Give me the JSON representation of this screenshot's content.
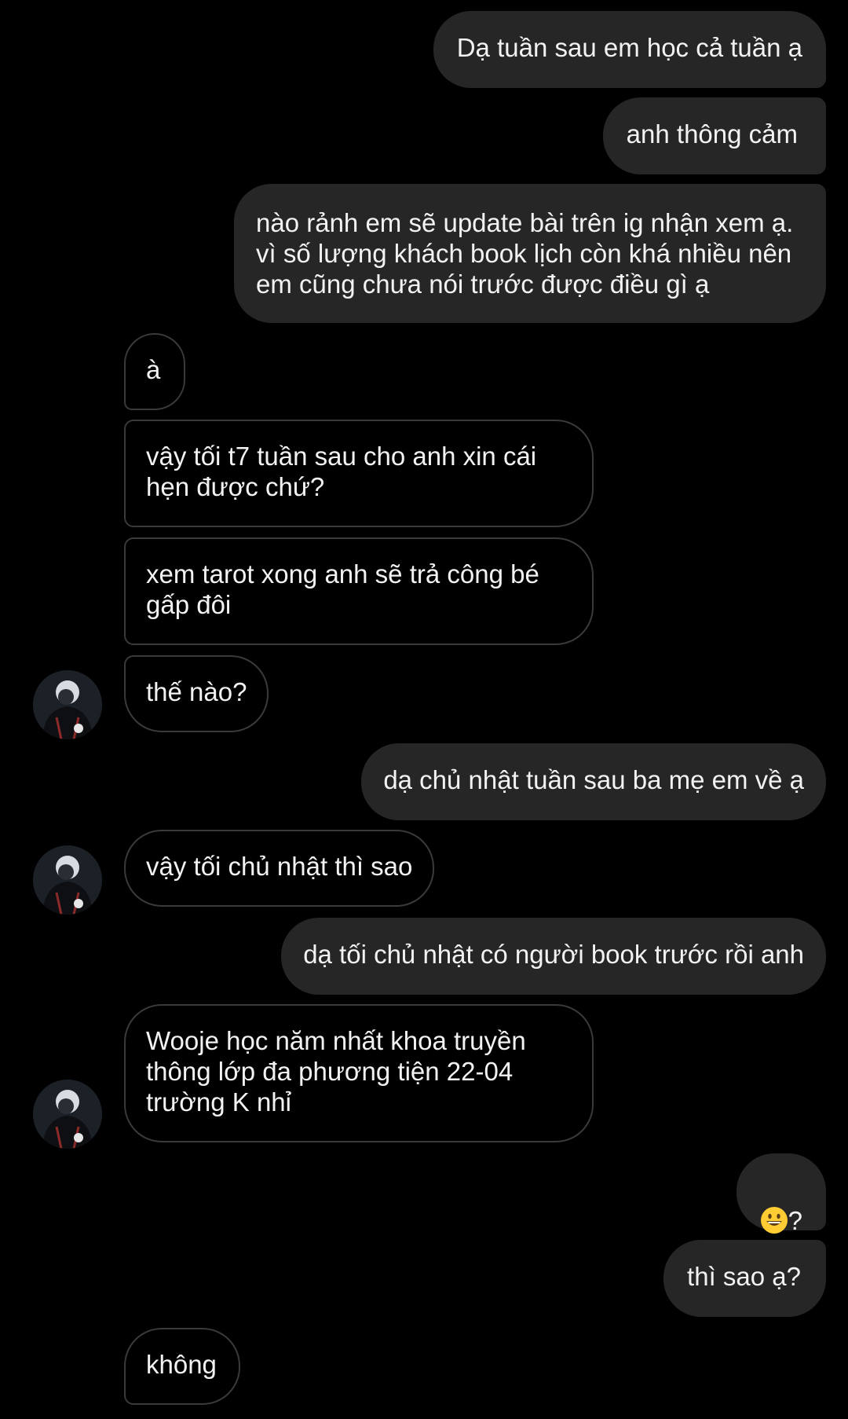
{
  "colors": {
    "background": "#000000",
    "outgoing_bubble": "#262626",
    "incoming_border": "#3a3a3a",
    "text": "#f2f2f2"
  },
  "messages": [
    {
      "id": "m1",
      "sender": "me",
      "text": "Dạ tuần sau em học cả tuần ạ"
    },
    {
      "id": "m2",
      "sender": "me",
      "text": "anh thông cảm"
    },
    {
      "id": "m3",
      "sender": "me",
      "text": "nào rảnh em sẽ update bài trên ig nhận xem ạ.\nvì số lượng khách book lịch còn khá nhiều nên\nem cũng chưa nói trước được điều gì ạ"
    },
    {
      "id": "m4",
      "sender": "them",
      "text": "à"
    },
    {
      "id": "m5",
      "sender": "them",
      "text": "vậy tối t7 tuần sau cho anh xin cái\nhẹn được chứ?"
    },
    {
      "id": "m6",
      "sender": "them",
      "text": "xem tarot xong anh sẽ trả công bé\ngấp đôi"
    },
    {
      "id": "m7",
      "sender": "them",
      "text": "thế nào?"
    },
    {
      "id": "m8",
      "sender": "me",
      "text": "dạ chủ nhật tuần sau ba mẹ em về ạ"
    },
    {
      "id": "m9",
      "sender": "them",
      "text": "vậy tối chủ nhật thì sao"
    },
    {
      "id": "m10",
      "sender": "me",
      "text": "dạ tối chủ nhật có người book trước rồi anh"
    },
    {
      "id": "m11",
      "sender": "them",
      "text": "Wooje học năm nhất khoa truyền\nthông lớp đa phương tiện 22-04\ntrường K nhỉ"
    },
    {
      "id": "m12",
      "sender": "me",
      "emoji": "grinning-face-emoji",
      "text": "?"
    },
    {
      "id": "m13",
      "sender": "me",
      "text": "thì sao ạ?"
    },
    {
      "id": "m14",
      "sender": "them",
      "text": "không"
    }
  ]
}
